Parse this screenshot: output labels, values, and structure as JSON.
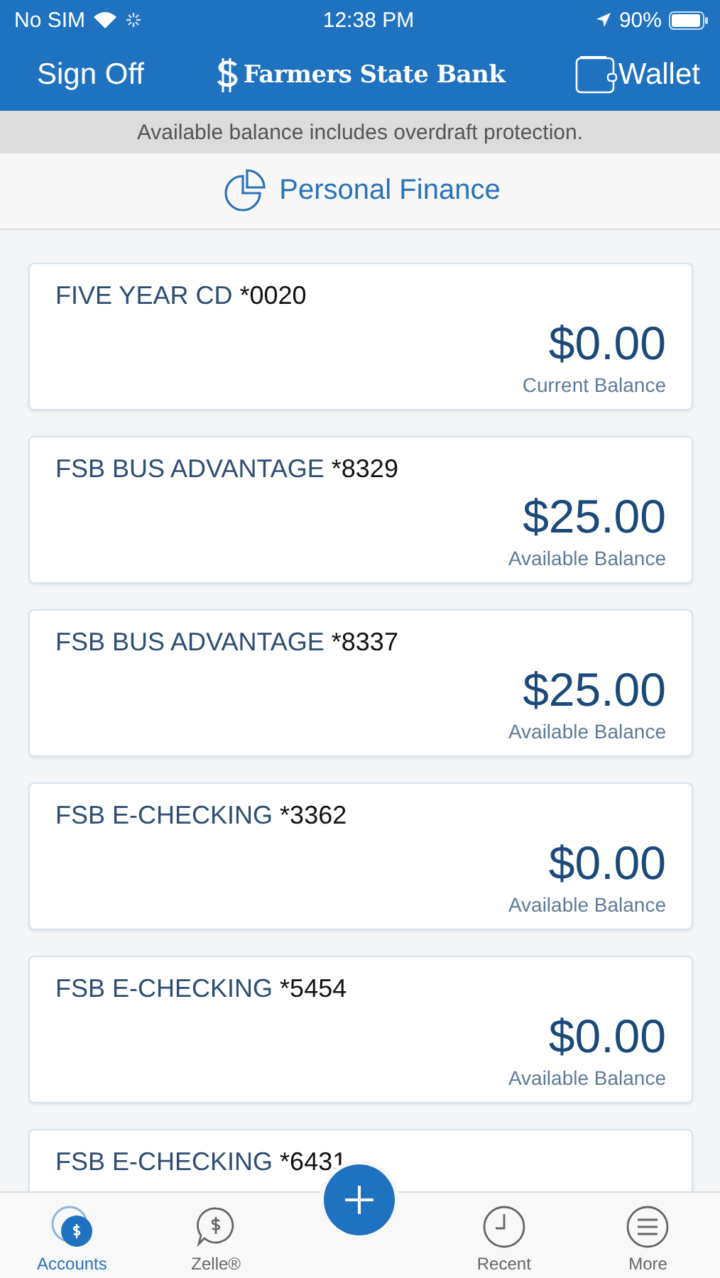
{
  "status_bar": {
    "carrier": "No SIM",
    "time": "12:38 PM",
    "battery": "90%"
  },
  "header": {
    "left_button": "Sign Off",
    "bank_name": "Farmers State Bank",
    "right_button": "Wallet"
  },
  "notice": "Available balance includes overdraft protection.",
  "personal_finance": "Personal Finance",
  "accounts": [
    {
      "name": "FIVE YEAR CD",
      "number": "*0020",
      "balance": "$0.00",
      "balance_label": "Current Balance"
    },
    {
      "name": "FSB BUS ADVANTAGE",
      "number": "*8329",
      "balance": "$25.00",
      "balance_label": "Available Balance"
    },
    {
      "name": "FSB BUS ADVANTAGE",
      "number": "*8337",
      "balance": "$25.00",
      "balance_label": "Available Balance"
    },
    {
      "name": "FSB E-CHECKING",
      "number": "*3362",
      "balance": "$0.00",
      "balance_label": "Available Balance"
    },
    {
      "name": "FSB E-CHECKING",
      "number": "*5454",
      "balance": "$0.00",
      "balance_label": "Available Balance"
    },
    {
      "name": "FSB E-CHECKING",
      "number": "*6431"
    }
  ],
  "tab_bar": [
    {
      "kind": "accounts",
      "label": "Accounts",
      "selected": true
    },
    {
      "kind": "zelle",
      "label": "Zelle®",
      "selected": false
    },
    {
      "kind": "add"
    },
    {
      "kind": "recent",
      "label": "Recent",
      "selected": false
    },
    {
      "kind": "more",
      "label": "More",
      "selected": false
    }
  ]
}
